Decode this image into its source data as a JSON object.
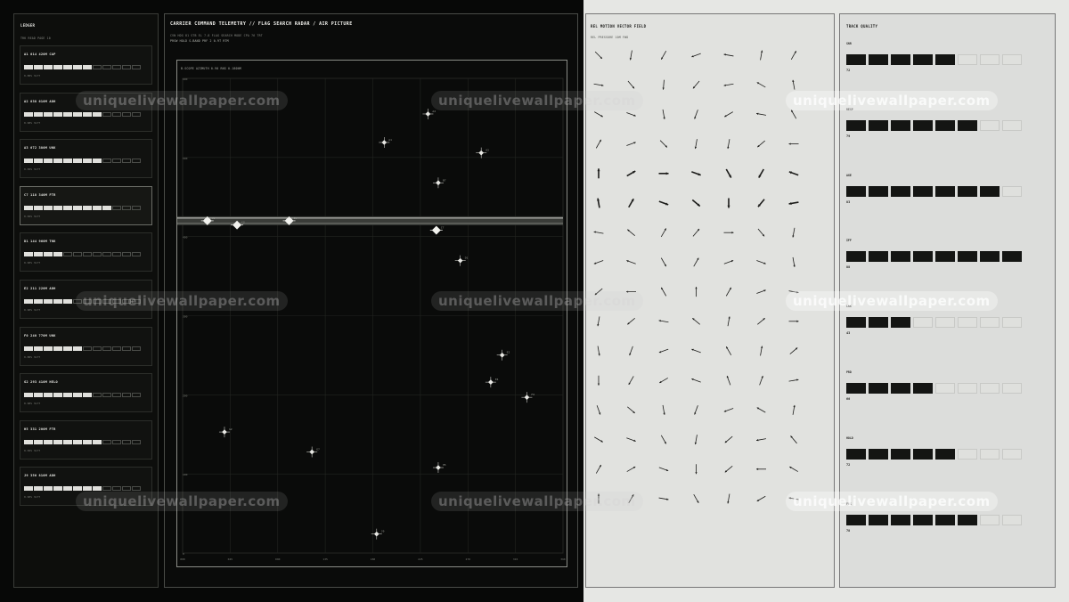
{
  "ledger": {
    "title": "LEDGER",
    "subtitle": "TRK READ PAGE 10",
    "items": [
      {
        "name": "A1 014 420M CAP",
        "meta": "0.88% 3LYT",
        "filled": 7,
        "active": false
      },
      {
        "name": "A2 038 610M ADH",
        "meta": "0.98% 3LYT",
        "filled": 8,
        "active": false
      },
      {
        "name": "A3 072 380M UNK",
        "meta": "0.99% 3LYT",
        "filled": 8,
        "active": false
      },
      {
        "name": "C7 118 340M FTR",
        "meta": "0.99% 3LYT",
        "filled": 9,
        "active": true
      },
      {
        "name": "D1 144 960M TNK",
        "meta": "0.90% 3LYT",
        "filled": 4,
        "active": false
      },
      {
        "name": "E2 211 220M ADH",
        "meta": "0.90% 3LYT",
        "filled": 5,
        "active": false
      },
      {
        "name": "F0 240 770M UNK",
        "meta": "0.88% 3LYT",
        "filled": 6,
        "active": false
      },
      {
        "name": "G2 293 410M HELO",
        "meta": "0.98% 3LYT",
        "filled": 7,
        "active": false
      },
      {
        "name": "H5 331 200M FTR",
        "meta": "0.99% 3LYT",
        "filled": 8,
        "active": false
      },
      {
        "name": "J9 356 810M ADH",
        "meta": "0.90% 3LYT",
        "filled": 8,
        "active": false
      }
    ]
  },
  "radar": {
    "title": "CARRIER COMMAND TELEMETRY  //  FLAG SEARCH RADAR / AIR PICTURE",
    "subtitle1": "CVN HDG 81   STB EL 7.8   FLAG SEARCH MODE   CPA 76 TRT",
    "subtitle2": "PRSW HOLD  S-BAND PRF 2  0.9T RTM",
    "scope_label": "B-SCOPE AZIMUTH 0-90 RNG 0-180NM",
    "y_ticks": [
      "600",
      "500",
      "400",
      "300",
      "200",
      "100",
      "0"
    ],
    "x_ticks": [
      "000",
      "045",
      "090",
      "135",
      "180",
      "225",
      "270",
      "315",
      "360"
    ],
    "contacts": [
      {
        "id": "A1",
        "x": 0.53,
        "y": 0.135,
        "selected": false
      },
      {
        "id": "A2",
        "x": 0.645,
        "y": 0.075,
        "selected": false
      },
      {
        "id": "A3",
        "x": 0.785,
        "y": 0.157,
        "selected": false
      },
      {
        "id": "B7",
        "x": 0.672,
        "y": 0.22,
        "selected": false
      },
      {
        "id": "C1",
        "x": 0.065,
        "y": 0.3,
        "selected": true
      },
      {
        "id": "C2",
        "x": 0.143,
        "y": 0.309,
        "selected": true
      },
      {
        "id": "C3",
        "x": 0.28,
        "y": 0.3,
        "selected": true
      },
      {
        "id": "C7",
        "x": 0.667,
        "y": 0.32,
        "selected": true
      },
      {
        "id": "D1",
        "x": 0.73,
        "y": 0.384,
        "selected": false
      },
      {
        "id": "E2",
        "x": 0.84,
        "y": 0.583,
        "selected": false
      },
      {
        "id": "E4",
        "x": 0.81,
        "y": 0.64,
        "selected": false
      },
      {
        "id": "F0",
        "x": 0.905,
        "y": 0.672,
        "selected": false
      },
      {
        "id": "G2",
        "x": 0.11,
        "y": 0.745,
        "selected": false
      },
      {
        "id": "G7",
        "x": 0.34,
        "y": 0.787,
        "selected": false
      },
      {
        "id": "H5",
        "x": 0.672,
        "y": 0.82,
        "selected": false
      },
      {
        "id": "J9",
        "x": 0.51,
        "y": 0.96,
        "selected": false
      }
    ],
    "band_y": 0.3
  },
  "vector_field": {
    "title": "REL MOTION VECTOR FIELD",
    "subtitle": "REL PRESSURE  10M FWD",
    "angles": [
      [
        45,
        100,
        120,
        160,
        190,
        280,
        300
      ],
      [
        10,
        50,
        95,
        130,
        170,
        210,
        260
      ],
      [
        30,
        20,
        80,
        110,
        150,
        190,
        240
      ],
      [
        300,
        340,
        45,
        100,
        100,
        140,
        180
      ],
      [
        270,
        330,
        0,
        20,
        60,
        120,
        200
      ],
      [
        260,
        300,
        20,
        40,
        90,
        130,
        170
      ],
      [
        190,
        220,
        300,
        310,
        0,
        50,
        100
      ],
      [
        160,
        200,
        60,
        300,
        340,
        20,
        80
      ],
      [
        140,
        180,
        240,
        270,
        300,
        340,
        10
      ],
      [
        100,
        140,
        190,
        220,
        280,
        320,
        0
      ],
      [
        80,
        110,
        160,
        200,
        240,
        280,
        320
      ],
      [
        90,
        120,
        150,
        200,
        250,
        290,
        350
      ],
      [
        70,
        40,
        80,
        110,
        160,
        210,
        280
      ],
      [
        30,
        20,
        60,
        100,
        140,
        170,
        230
      ],
      [
        300,
        330,
        20,
        90,
        140,
        180,
        210
      ],
      [
        270,
        300,
        10,
        60,
        100,
        150,
        190
      ]
    ]
  },
  "track_quality": {
    "title": "TRACK QUALITY",
    "rows": [
      {
        "label": "SNR",
        "value": "72",
        "filled": 5
      },
      {
        "label": "RESP",
        "value": "79",
        "filled": 6
      },
      {
        "label": "AGE",
        "value": "83",
        "filled": 7
      },
      {
        "label": "IFF",
        "value": "88",
        "filled": 8
      },
      {
        "label": "LNK",
        "value": "43",
        "filled": 3
      },
      {
        "label": "PRD",
        "value": "60",
        "filled": 4
      },
      {
        "label": "HOLD",
        "value": "72",
        "filled": 5
      },
      {
        "label": "FUS",
        "value": "78",
        "filled": 6
      }
    ]
  },
  "watermark": "uniquelivewallpaper.com"
}
